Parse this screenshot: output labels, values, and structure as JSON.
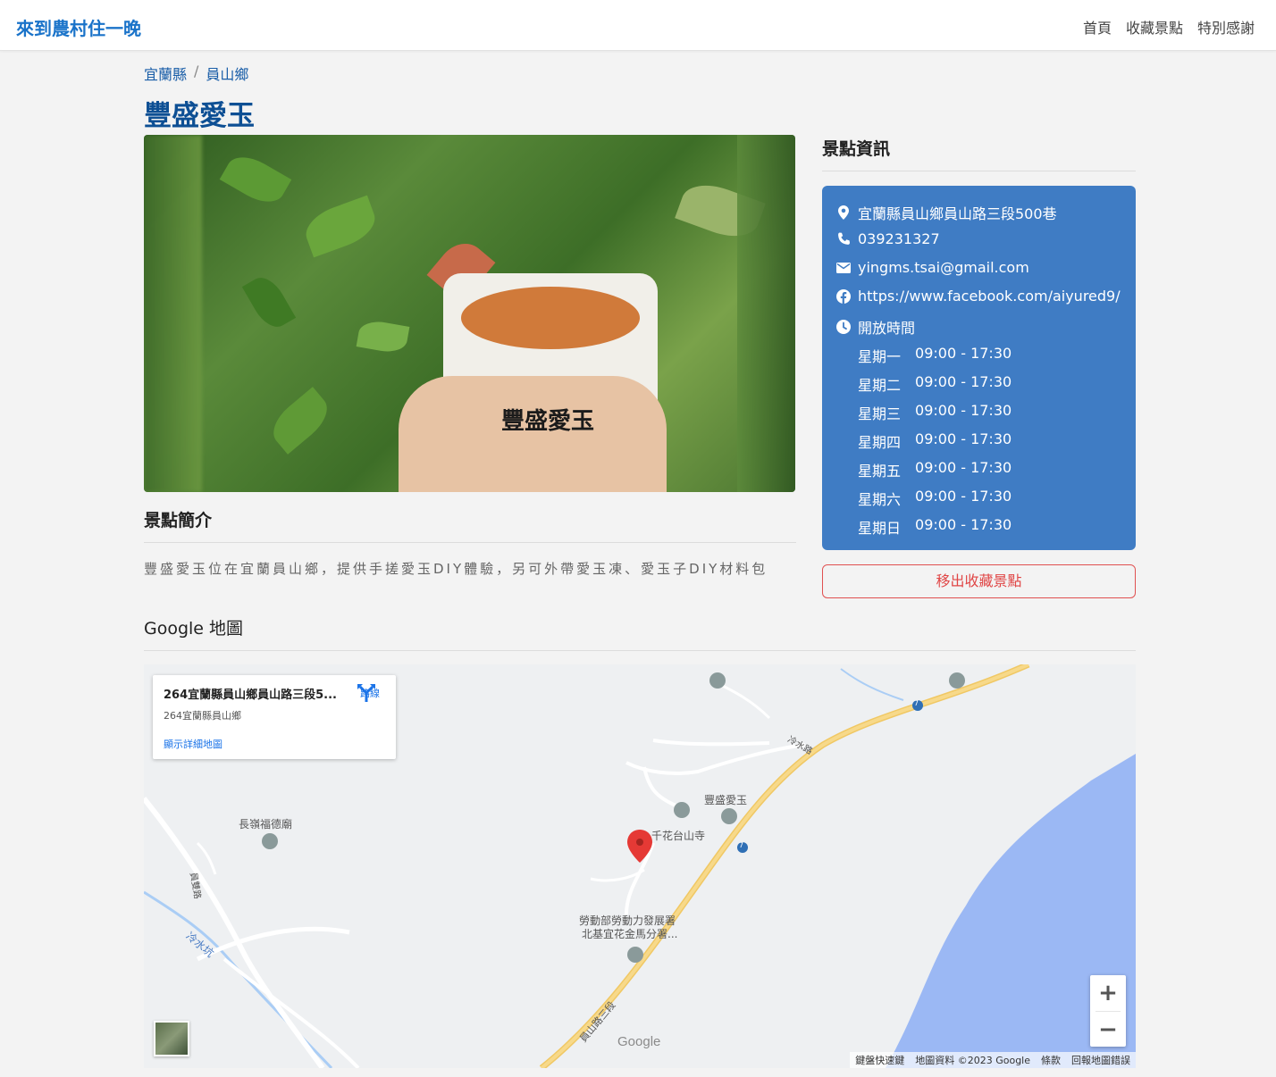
{
  "nav": {
    "brand": "來到農村住一晚",
    "links": [
      "首頁",
      "收藏景點",
      "特別感謝"
    ]
  },
  "breadcrumb": [
    "宜蘭縣",
    "員山鄉"
  ],
  "breadcrumb_sep": "/",
  "title": "豐盛愛玉",
  "photo": {
    "cup_text": "豐盛愛玉"
  },
  "intro": {
    "heading": "景點簡介",
    "text": "豐盛愛玉位在宜蘭員山鄉，提供手搓愛玉DIY體驗，另可外帶愛玉凍、愛玉子DIY材料包"
  },
  "info": {
    "heading": "景點資訊",
    "address": "宜蘭縣員山鄉員山路三段500巷",
    "phone": "039231327",
    "email": "yingms.tsai@gmail.com",
    "facebook": "https://www.facebook.com/aiyured9/",
    "hours_label": "開放時間",
    "hours": [
      {
        "day": "星期一",
        "time": "09:00 - 17:30"
      },
      {
        "day": "星期二",
        "time": "09:00 - 17:30"
      },
      {
        "day": "星期三",
        "time": "09:00 - 17:30"
      },
      {
        "day": "星期四",
        "time": "09:00 - 17:30"
      },
      {
        "day": "星期五",
        "time": "09:00 - 17:30"
      },
      {
        "day": "星期六",
        "time": "09:00 - 17:30"
      },
      {
        "day": "星期日",
        "time": "09:00 - 17:30"
      }
    ],
    "card_color": "#3f7cc4"
  },
  "remove_button": "移出收藏景點",
  "map": {
    "heading": "Google 地圖",
    "card_title": "264宜蘭縣員山鄉員山路三段5...",
    "card_sub": "264宜蘭縣員山鄉",
    "detail_link": "顯示詳細地圖",
    "route_label": "路線",
    "labels": {
      "temple1": "長嶺福德廟",
      "shop": "豐盛愛玉",
      "temple2": "千花台山寺",
      "agency1": "勞動部勞動力發展署",
      "agency2": "北基宜花金馬分署...",
      "road1": "冷水路",
      "road2": "員山路三段",
      "river": "冷水坑",
      "road3": "員雙路",
      "route_num": "7"
    },
    "zoom_in": "+",
    "zoom_out": "−",
    "google": "Google",
    "footer": [
      "鍵盤快速鍵",
      "地圖資料 ©2023 Google",
      "條款",
      "回報地圖錯誤"
    ]
  }
}
